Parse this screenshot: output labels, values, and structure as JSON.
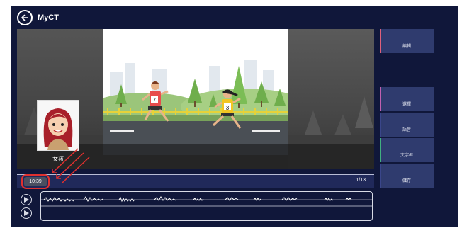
{
  "header": {
    "title": "MyCT"
  },
  "video": {
    "character_name": "女孩"
  },
  "side_panel": {
    "buttons": [
      {
        "label": "編輯",
        "accent": "#e0607a"
      },
      {
        "label": "選擇",
        "accent": "#c060b0"
      },
      {
        "label": "語音",
        "accent": "#3a468a"
      },
      {
        "label": "文字框",
        "accent": "#40b080"
      },
      {
        "label": "儲存",
        "accent": "#3a468a"
      }
    ]
  },
  "timeline": {
    "current_time": "10:39",
    "page": "1/13"
  },
  "colors": {
    "background": "#10173a",
    "panel_button": "#2f3b6e",
    "highlight": "#e0302e"
  }
}
